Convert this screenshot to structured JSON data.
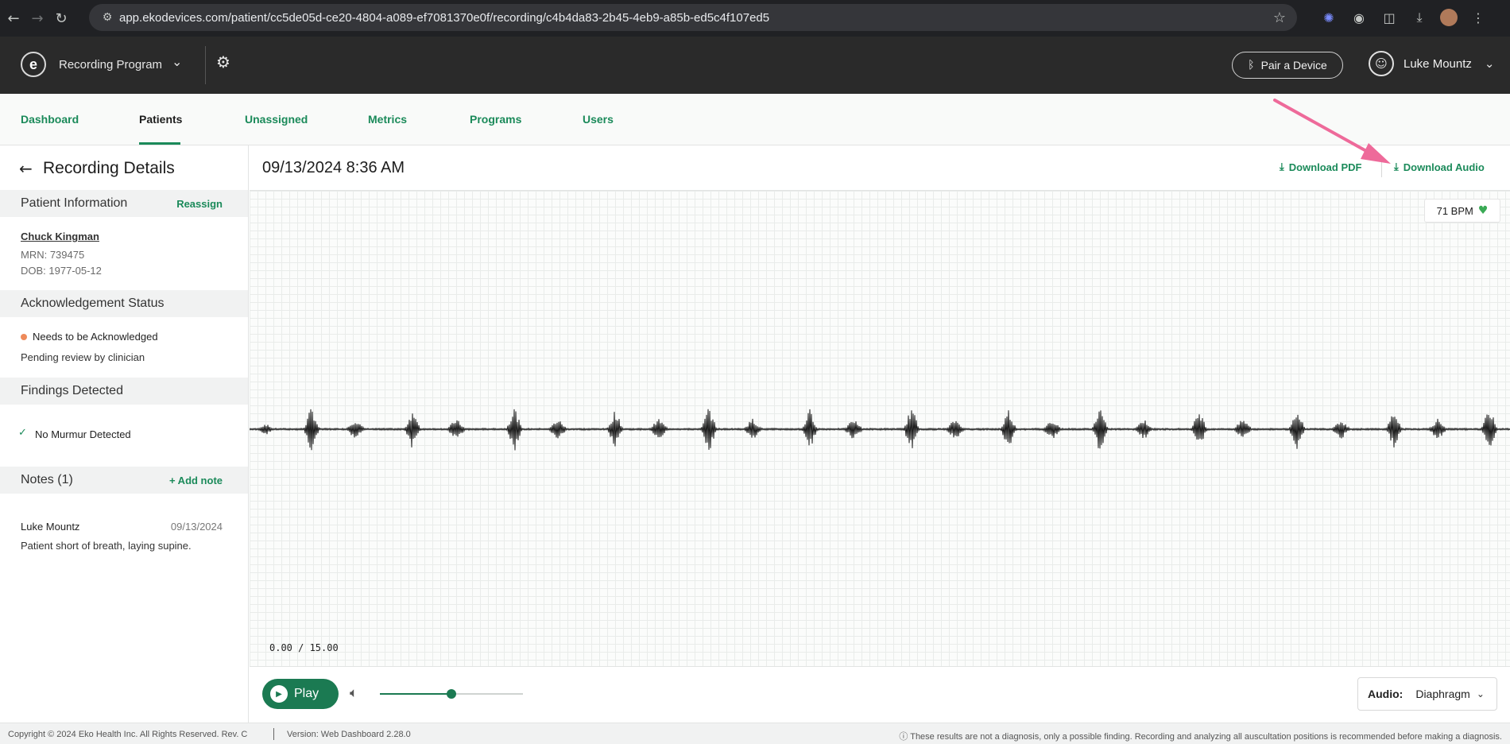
{
  "browser": {
    "url": "app.ekodevices.com/patient/cc5de05d-ce20-4804-a089-ef7081370e0f/recording/c4b4da83-2b45-4eb9-a85b-ed5c4f107ed5"
  },
  "header": {
    "logo_letter": "e",
    "program_name": "Recording Program",
    "pair_device_label": "Pair a Device",
    "user_name": "Luke Mountz"
  },
  "nav": {
    "tabs": [
      {
        "label": "Dashboard"
      },
      {
        "label": "Patients"
      },
      {
        "label": "Unassigned"
      },
      {
        "label": "Metrics"
      },
      {
        "label": "Programs"
      },
      {
        "label": "Users"
      }
    ],
    "active": "Patients"
  },
  "sidebar": {
    "title": "Recording Details",
    "patient_section": {
      "title": "Patient Information",
      "action": "Reassign"
    },
    "patient": {
      "name": "Chuck Kingman",
      "mrn": "MRN: 739475",
      "dob": "DOB: 1977-05-12"
    },
    "ack_section": {
      "title": "Acknowledgement Status"
    },
    "ack": {
      "status": "Needs to be Acknowledged",
      "sub": "Pending review by clinician",
      "dot_color": "#ee8a5a"
    },
    "findings_section": {
      "title": "Findings Detected"
    },
    "findings": {
      "item": "No Murmur Detected"
    },
    "notes_section": {
      "title": "Notes (1)",
      "action": "+ Add note"
    },
    "note": {
      "author": "Luke Mountz",
      "date": "09/13/2024",
      "text": "Patient short of breath, laying supine."
    }
  },
  "main": {
    "recording_datetime": "09/13/2024 8:36 AM",
    "download_pdf": "Download PDF",
    "download_audio": "Download Audio",
    "bpm": "71 BPM",
    "time_readout": "0.00 / 15.00",
    "play_label": "Play",
    "volume_level": 0.5,
    "audio_label": "Audio:",
    "audio_value": "Diaphragm"
  },
  "footer": {
    "copyright": "Copyright © 2024 Eko Health Inc. All Rights Reserved. Rev. C",
    "version": "Version: Web Dashboard 2.28.0",
    "disclaimer": "These results are not a diagnosis, only a possible finding. Recording and analyzing all auscultation positions is recommended before making a diagnosis."
  },
  "colors": {
    "accent": "#1b8a5a",
    "header_bg": "#2a2a2a",
    "annotation_arrow": "#ee6a9a"
  }
}
